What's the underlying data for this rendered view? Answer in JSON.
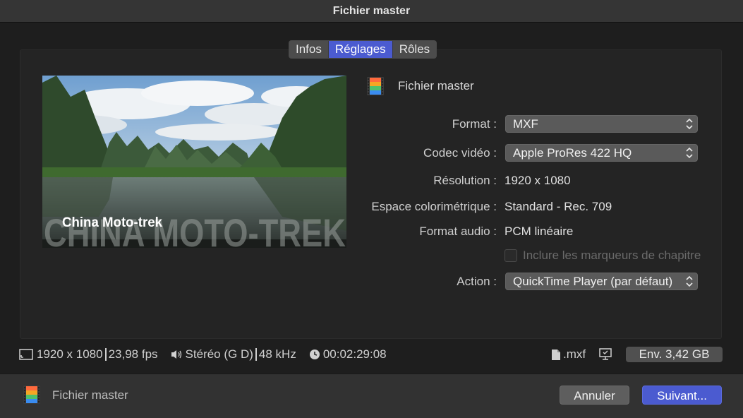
{
  "window": {
    "title": "Fichier master"
  },
  "tabs": [
    {
      "label": "Infos",
      "active": false
    },
    {
      "label": "Réglages",
      "active": true
    },
    {
      "label": "Rôles",
      "active": false
    }
  ],
  "preview": {
    "caption_small": "China Moto-trek",
    "caption_large": "CHINA MOTO-TREK"
  },
  "settings": {
    "header_title": "Fichier master",
    "format": {
      "label": "Format :",
      "value": "MXF"
    },
    "codec": {
      "label": "Codec vidéo :",
      "value": "Apple ProRes 422 HQ"
    },
    "resolution": {
      "label": "Résolution :",
      "value": "1920 x 1080"
    },
    "colorspace": {
      "label": "Espace colorimétrique :",
      "value": "Standard - Rec. 709"
    },
    "audio_format": {
      "label": "Format audio :",
      "value": "PCM linéaire"
    },
    "chapter_markers": {
      "label": "Inclure les marqueurs de chapitre",
      "checked": false,
      "enabled": false
    },
    "action": {
      "label": "Action :",
      "value": "QuickTime Player (par défaut)"
    }
  },
  "infobar": {
    "resolution": "1920 x 1080",
    "fps": "23,98 fps",
    "audio": "Stéréo (G D)",
    "sample_rate": "48 kHz",
    "duration": "00:02:29:08",
    "extension": ".mxf",
    "size": "Env. 3,42 GB"
  },
  "footer": {
    "title": "Fichier master",
    "cancel_label": "Annuler",
    "next_label": "Suivant..."
  },
  "colors": {
    "accent": "#4b5bd0",
    "background": "#1e1e1e",
    "panel": "#242424"
  }
}
